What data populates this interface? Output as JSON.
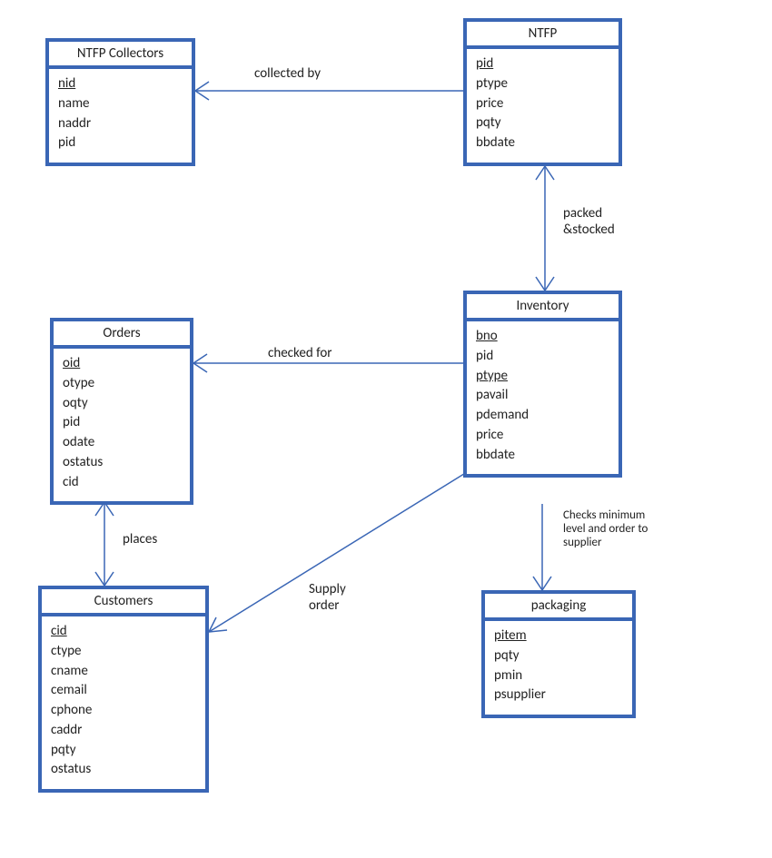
{
  "entities": {
    "ntfp_collectors": {
      "title": "NTFP Collectors",
      "attrs": [
        {
          "name": "nid",
          "pk": true
        },
        {
          "name": "name",
          "pk": false
        },
        {
          "name": "naddr",
          "pk": false
        },
        {
          "name": "pid",
          "pk": false
        }
      ]
    },
    "ntfp": {
      "title": "NTFP",
      "attrs": [
        {
          "name": "pid",
          "pk": true
        },
        {
          "name": "ptype",
          "pk": false
        },
        {
          "name": "price",
          "pk": false
        },
        {
          "name": "pqty",
          "pk": false
        },
        {
          "name": "bbdate",
          "pk": false
        }
      ]
    },
    "orders": {
      "title": "Orders",
      "attrs": [
        {
          "name": "oid",
          "pk": true
        },
        {
          "name": "otype",
          "pk": false
        },
        {
          "name": "oqty",
          "pk": false
        },
        {
          "name": "pid",
          "pk": false
        },
        {
          "name": "odate",
          "pk": false
        },
        {
          "name": "ostatus",
          "pk": false
        },
        {
          "name": "cid",
          "pk": false
        }
      ]
    },
    "inventory": {
      "title": "Inventory",
      "attrs": [
        {
          "name": "bno",
          "pk": true
        },
        {
          "name": "pid",
          "pk": false
        },
        {
          "name": "ptype",
          "pk": true
        },
        {
          "name": "pavail",
          "pk": false
        },
        {
          "name": "pdemand",
          "pk": false
        },
        {
          "name": "price",
          "pk": false
        },
        {
          "name": "bbdate",
          "pk": false
        }
      ]
    },
    "customers": {
      "title": "Customers",
      "attrs": [
        {
          "name": "cid",
          "pk": true
        },
        {
          "name": "ctype",
          "pk": false
        },
        {
          "name": "cname",
          "pk": false
        },
        {
          "name": "cemail",
          "pk": false
        },
        {
          "name": "cphone",
          "pk": false
        },
        {
          "name": "caddr",
          "pk": false
        },
        {
          "name": "pqty",
          "pk": false
        },
        {
          "name": "ostatus",
          "pk": false
        }
      ]
    },
    "packaging": {
      "title": "packaging",
      "attrs": [
        {
          "name": "pitem",
          "pk": true
        },
        {
          "name": "pqty",
          "pk": false
        },
        {
          "name": "pmin",
          "pk": false
        },
        {
          "name": "psupplier",
          "pk": false
        }
      ]
    }
  },
  "relationships": {
    "collected_by": "collected by",
    "packed_stocked": "packed\n&stocked",
    "checked_for": "checked for",
    "places": "places",
    "supply_order": "Supply\norder",
    "checks_min": "Checks minimum\nlevel and order to\nsupplier"
  }
}
